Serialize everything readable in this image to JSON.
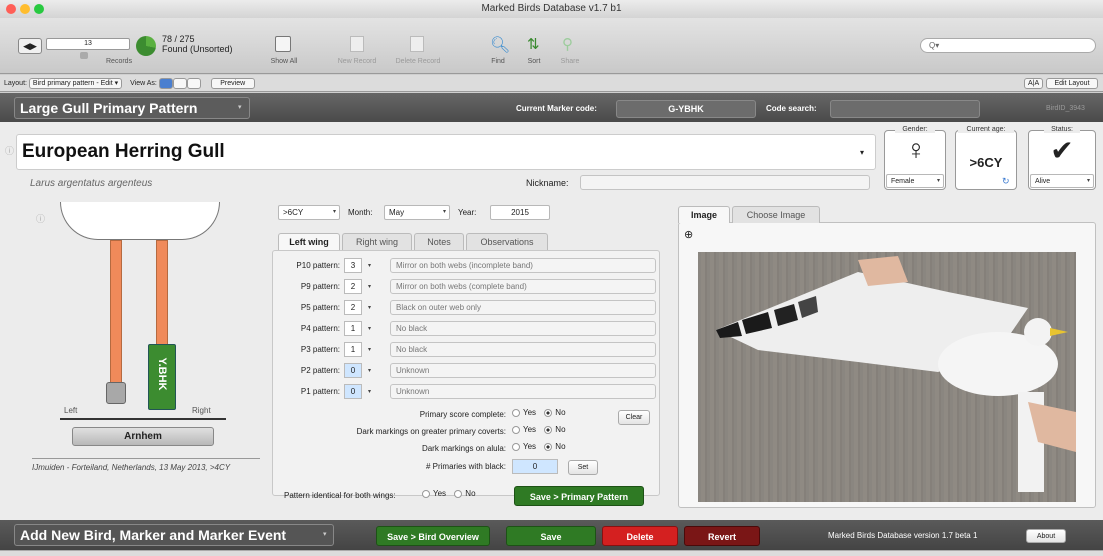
{
  "window": {
    "title": "Marked Birds Database v1.7 b1"
  },
  "toolbar": {
    "record_number": "13",
    "record_count": "78 / 275",
    "found_state": "Found (Unsorted)",
    "records_label": "Records",
    "show_all": "Show All",
    "new_record": "New Record",
    "delete_record": "Delete Record",
    "find": "Find",
    "sort": "Sort",
    "share": "Share",
    "search_placeholder": "Q▾"
  },
  "layout_bar": {
    "layout_label": "Layout:",
    "layout_value": "Bird primary pattern - Edit",
    "view_as": "View As:",
    "preview": "Preview",
    "aa": "A|A",
    "edit_layout": "Edit Layout"
  },
  "header": {
    "title": "Large Gull Primary Pattern",
    "current_marker_label": "Current Marker code:",
    "current_marker_value": "G-YBHK",
    "code_search_label": "Code search:",
    "code_search_value": "",
    "bird_id": "BirdID_3943"
  },
  "bird": {
    "common_name": "European Herring Gull",
    "latin_name": "Larus argentatus argenteus",
    "nickname_label": "Nickname:",
    "nickname_value": "",
    "gender_label": "Gender:",
    "gender_symbol": "♀",
    "gender_value": "Female",
    "age_label": "Current age:",
    "age_value": ">6CY",
    "status_label": "Status:",
    "status_symbol": "✔",
    "status_value": "Alive"
  },
  "leg_diagram": {
    "ring_code": "Y.BHK",
    "left_label": "Left",
    "right_label": "Right",
    "location_button": "Arnhem",
    "ring_note": "IJmuiden - Forteiland, Netherlands, 13 May 2013, >4CY",
    "colors": {
      "leg": "#f08a5a",
      "ring": "#3c8c30",
      "metal": "#a8a8a8"
    }
  },
  "date": {
    "age": ">6CY",
    "month_label": "Month:",
    "month_value": "May",
    "year_label": "Year:",
    "year_value": "2015"
  },
  "tabs": [
    "Left wing",
    "Right wing",
    "Notes",
    "Observations"
  ],
  "patterns": [
    {
      "label": "P10 pattern:",
      "value": "3",
      "description": "Mirror on both webs (incomplete band)",
      "highlight": false
    },
    {
      "label": "P9 pattern:",
      "value": "2",
      "description": "Mirror on both webs (complete band)",
      "highlight": false
    },
    {
      "label": "P5 pattern:",
      "value": "2",
      "description": "Black on outer web only",
      "highlight": false
    },
    {
      "label": "P4 pattern:",
      "value": "1",
      "description": "No black",
      "highlight": false
    },
    {
      "label": "P3 pattern:",
      "value": "1",
      "description": "No black",
      "highlight": false
    },
    {
      "label": "P2 pattern:",
      "value": "0",
      "description": "Unknown",
      "highlight": true
    },
    {
      "label": "P1 pattern:",
      "value": "0",
      "description": "Unknown",
      "highlight": true
    }
  ],
  "questions": {
    "score_complete": "Primary score complete:",
    "coverts": "Dark markings on greater primary coverts:",
    "alula": "Dark markings on alula:",
    "primaries_black": "# Primaries with black:",
    "primaries_black_value": "0",
    "yes": "Yes",
    "no": "No",
    "clear": "Clear",
    "set": "Set",
    "identical": "Pattern identical for both wings:",
    "save_pattern": "Save > Primary Pattern"
  },
  "image_panel": {
    "tab_image": "Image",
    "tab_choose": "Choose Image"
  },
  "footer": {
    "title": "Add New Bird, Marker and Marker Event",
    "save_overview": "Save > Bird Overview",
    "save": "Save",
    "delete": "Delete",
    "revert": "Revert",
    "version": "Marked Birds Database version 1.7 beta 1",
    "about": "About"
  },
  "colors": {
    "green_button": "#2f7a24",
    "red_button": "#d42020",
    "dark_red_button": "#7a1616",
    "header_bg": "#545454"
  }
}
